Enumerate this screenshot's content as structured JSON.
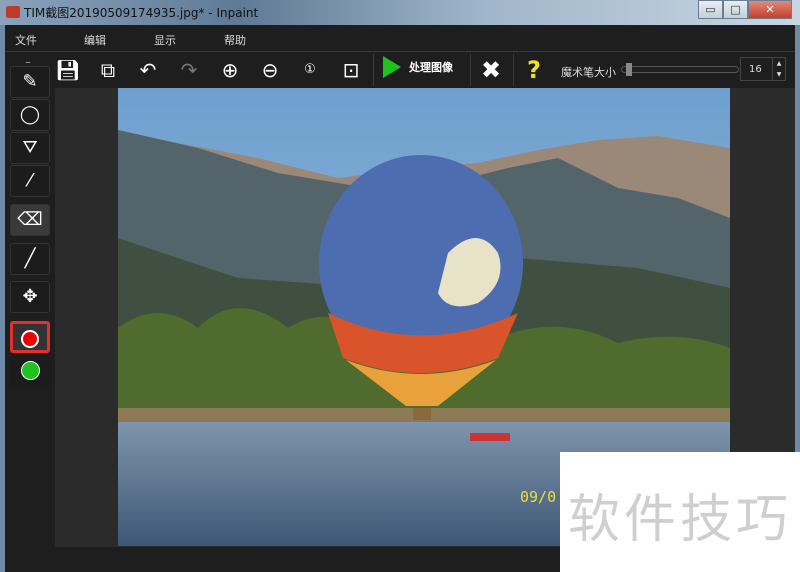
{
  "window": {
    "title": "TIM截图20190509174935.jpg* - Inpaint",
    "min": "▭",
    "max": "□",
    "close": "✕"
  },
  "menu": [
    "文件",
    "编辑",
    "显示",
    "帮助"
  ],
  "toolbar": {
    "process_label": "处理图像",
    "brush_size_label": "魔术笔大小",
    "brush_size_value": "16",
    "brush_size_fraction": 0.02
  },
  "image": {
    "date_stamp": "09/0"
  },
  "colors": {
    "accent_green": "#1ec31e",
    "help_yellow": "#f0e020",
    "selected_border": "#e03030"
  },
  "watermark": "软件技巧"
}
